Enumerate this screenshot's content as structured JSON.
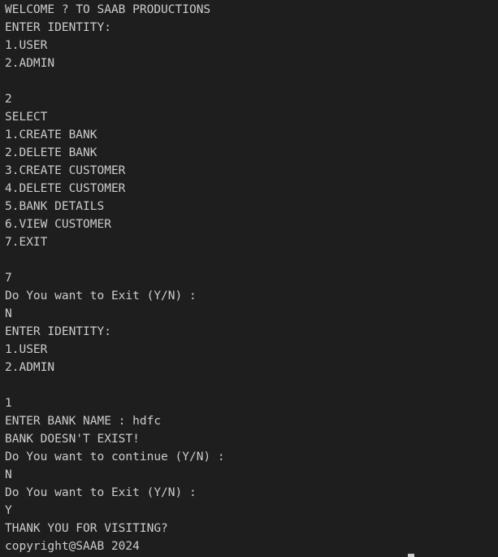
{
  "terminal": {
    "lines": [
      "WELCOME ? TO SAAB PRODUCTIONS",
      "ENTER IDENTITY:",
      "1.USER",
      "2.ADMIN",
      "",
      "2",
      "SELECT",
      "1.CREATE BANK",
      "2.DELETE BANK",
      "3.CREATE CUSTOMER",
      "4.DELETE CUSTOMER",
      "5.BANK DETAILS",
      "6.VIEW CUSTOMER",
      "7.EXIT",
      "",
      "7",
      "Do You want to Exit (Y/N) :",
      "N",
      "ENTER IDENTITY:",
      "1.USER",
      "2.ADMIN",
      "",
      "1",
      "ENTER BANK NAME : hdfc",
      "BANK DOESN'T EXIST!",
      "Do You want to continue (Y/N) :",
      "N",
      "Do You want to Exit (Y/N) :",
      "Y",
      "THANK YOU FOR VISITING?",
      "copyright@SAAB 2024"
    ]
  },
  "colors": {
    "background": "#1e1e1e",
    "text": "#cccccc"
  }
}
